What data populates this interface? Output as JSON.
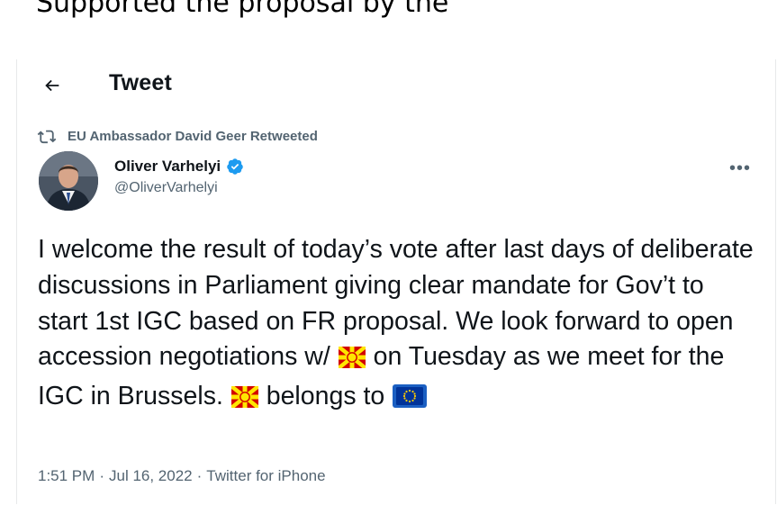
{
  "page_top_text": "Supported the proposal by the",
  "header": {
    "title": "Tweet"
  },
  "retweet_context": {
    "text": "EU Ambassador David Geer Retweeted"
  },
  "author": {
    "name": "Oliver Varhelyi",
    "handle": "@OliverVarhelyi",
    "verified": true
  },
  "tweet": {
    "text_part1": "I welcome the result of today’s vote after last days of deliberate discussions in Parliament giving clear mandate for Gov’t to start 1st IGC based on FR proposal. We look forward to open accession negotiations w/",
    "text_part2": "on Tuesday as we meet for the IGC in Brussels.",
    "text_part3": "belongs to",
    "emojis": [
      "flag-north-macedonia",
      "flag-north-macedonia",
      "flag-eu"
    ]
  },
  "meta": {
    "time": "1:51 PM",
    "separator1": "·",
    "date": "Jul 16, 2022",
    "separator2": "·",
    "source": "Twitter for iPhone"
  },
  "icons": {
    "back": "back-arrow-icon",
    "retweet": "retweet-icon",
    "verified": "verified-badge-icon",
    "more": "more-options-icon"
  },
  "colors": {
    "text": "#0f1419",
    "secondary": "#536471",
    "verified": "#1d9bf0",
    "border": "#e7e9ea",
    "mk_red": "#d20000",
    "mk_yellow": "#ffe600",
    "eu_blue": "#003399",
    "eu_gold": "#ffcc00"
  }
}
